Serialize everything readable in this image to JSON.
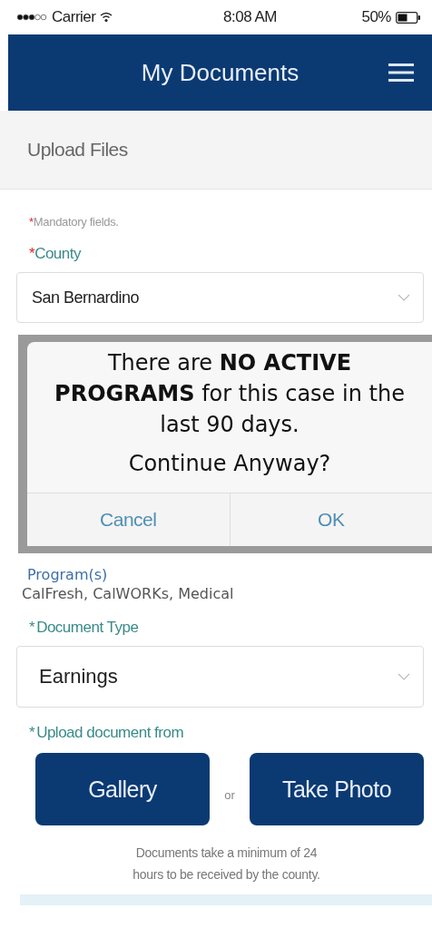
{
  "status_bar": {
    "carrier": "Carrier",
    "time": "8:08 AM",
    "battery": "50%"
  },
  "nav": {
    "title": "My Documents"
  },
  "section": {
    "title": "Upload Files"
  },
  "mandatory_note": {
    "mark": "*",
    "text": "Mandatory fields."
  },
  "county": {
    "label": "County",
    "required": true,
    "value": "San Bernardino"
  },
  "dialog": {
    "message": "There are **NO ACTIVE PROGRAMS** for this case in the last 90 days.",
    "question": "Continue Anyway?",
    "buttons": [
      "Cancel",
      "OK"
    ]
  },
  "programs": {
    "label": "Program(s)",
    "value": "CalFresh, CalWORKs, Medical"
  },
  "document_type": {
    "label": "Document Type",
    "required": true,
    "value": "Earnings"
  },
  "upload": {
    "label": "Upload document from",
    "required": true,
    "buttons": [
      "Gallery",
      "Take Photo"
    ],
    "separator": "or"
  },
  "note": "Documents take a minimum of 24 hours to be received by the county."
}
